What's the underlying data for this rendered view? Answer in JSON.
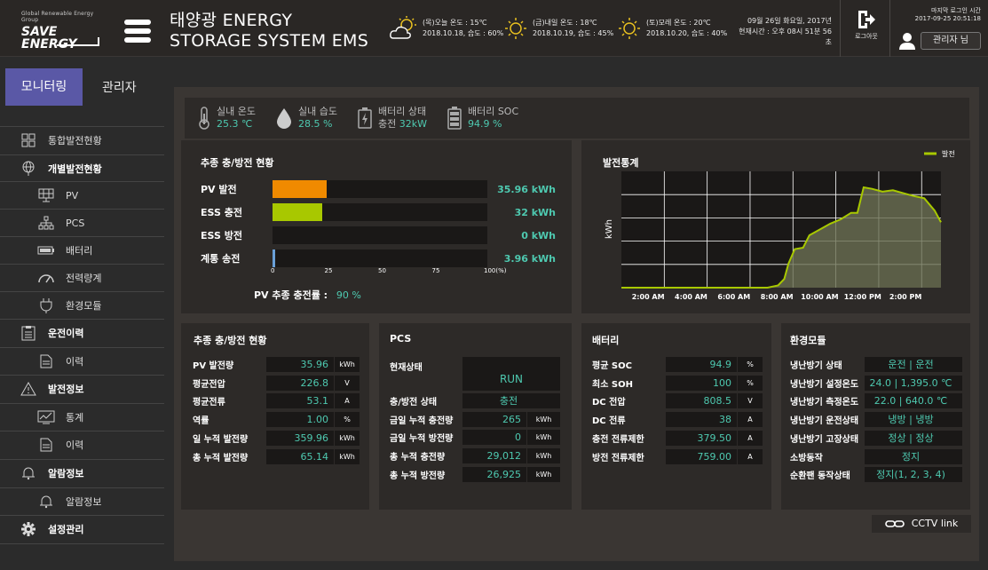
{
  "header": {
    "logo_top": "Global Renewable Energy Group",
    "logo_line1": "SAVE",
    "logo_line2": "ENERGY",
    "title_line1": "태양광 ENERGY",
    "title_line2": "STORAGE SYSTEM EMS",
    "weather": [
      {
        "line1": "(목)오늘  온도 : 15℃",
        "line2": "2018.10.18,  습도 : 60%",
        "icon": "sun-cloud-icon"
      },
      {
        "line1": "(금)내일  온도 : 18℃",
        "line2": "2018.10.19,  습도 : 45%",
        "icon": "sun-icon"
      },
      {
        "line1": "(토)모레  온도 : 20℃",
        "line2": "2018.10.20,  습도 : 40%",
        "icon": "sun-icon"
      }
    ],
    "date_line1": "09월 26일 화요일, 2017년",
    "date_line2": "현재시간 : 오후 08시 51분 56초",
    "logout_label": "로그아웃",
    "last_login_label": "마지막 로그인 시간",
    "last_login_value": "2017-09-25  20:51:18",
    "admin_label": "관리자 님"
  },
  "sidebar": {
    "tab_active": "모니터링",
    "tab_other": "관리자",
    "items": [
      {
        "label": "통합발전현황",
        "icon": "grid-icon",
        "bold": false,
        "sub": false
      },
      {
        "label": "개별발전현황",
        "icon": "globe-icon",
        "bold": true,
        "sub": false
      },
      {
        "label": "PV",
        "icon": "solar-panel-icon",
        "bold": false,
        "sub": true
      },
      {
        "label": "PCS",
        "icon": "network-icon",
        "bold": false,
        "sub": true
      },
      {
        "label": "배터리",
        "icon": "battery-icon",
        "bold": false,
        "sub": true
      },
      {
        "label": "전력량계",
        "icon": "gauge-icon",
        "bold": false,
        "sub": true
      },
      {
        "label": "환경모듈",
        "icon": "plug-icon",
        "bold": false,
        "sub": true
      },
      {
        "label": "운전이력",
        "icon": "clipboard-icon",
        "bold": true,
        "sub": false
      },
      {
        "label": "이력",
        "icon": "document-icon",
        "bold": false,
        "sub": true
      },
      {
        "label": "발전정보",
        "icon": "warning-icon",
        "bold": true,
        "sub": false
      },
      {
        "label": "통계",
        "icon": "chart-icon",
        "bold": false,
        "sub": true
      },
      {
        "label": "이력",
        "icon": "document-icon",
        "bold": false,
        "sub": true
      },
      {
        "label": "알람정보",
        "icon": "bell-icon",
        "bold": true,
        "sub": false
      },
      {
        "label": "알람정보",
        "icon": "bell-icon",
        "bold": false,
        "sub": true
      },
      {
        "label": "설정관리",
        "icon": "gear-icon",
        "bold": true,
        "sub": false
      }
    ]
  },
  "env": [
    {
      "label": "실내 온도",
      "value": "25.3 ℃",
      "icon": "thermometer-icon"
    },
    {
      "label": "실내 습도",
      "value": "28.5 %",
      "icon": "droplet-icon"
    },
    {
      "label": "배터리 상태",
      "value_prefix": "충전",
      "value": "32kW",
      "icon": "battery-charge-icon"
    },
    {
      "label": "배터리 SOC",
      "value": "94.9 %",
      "icon": "battery-full-icon"
    }
  ],
  "charge_panel": {
    "title": "추종 충/방전 현황",
    "rows": [
      {
        "label": "PV 발전",
        "fill": 0.25,
        "color": "#f08a00",
        "value": "35.96 kWh"
      },
      {
        "label": "ESS 충전",
        "fill": 0.23,
        "color": "#a8c800",
        "value": "32 kWh"
      },
      {
        "label": "ESS 방전",
        "fill": 0,
        "color": "#a8c800",
        "value": "0 kWh"
      },
      {
        "label": "계통 송전",
        "fill": 0.012,
        "color": "#6aa0d8",
        "value": "3.96 kWh"
      }
    ],
    "ticks": [
      "0",
      "25",
      "50",
      "75",
      "100(%)"
    ],
    "rate_label": "PV 추종 충전률 :",
    "rate_value": "90 %"
  },
  "chart_data": {
    "type": "area",
    "title": "발전통계",
    "ylabel": "kWh",
    "legend": "발전",
    "legend_position": "top-right",
    "x_ticks": [
      "2:00 AM",
      "4:00 AM",
      "6:00 AM",
      "8:00 AM",
      "10:00 AM",
      "12:00 PM",
      "2:00 PM"
    ],
    "series": [
      {
        "name": "발전",
        "color": "#a8c800",
        "x": [
          0,
          1,
          2,
          3,
          4,
          5,
          6,
          7,
          7.5,
          7.8,
          8,
          8.3,
          8.7,
          9,
          9.5,
          10,
          10.5,
          11,
          11.3,
          11.6,
          12,
          12.5,
          13,
          13.5,
          14,
          14.5,
          15,
          15.3
        ],
        "y": [
          0,
          0,
          0,
          0,
          0,
          0,
          0,
          0,
          0.3,
          1.2,
          3.3,
          5.3,
          5.5,
          7.2,
          8,
          8.8,
          9.4,
          10.3,
          10.3,
          13.8,
          13.6,
          13.2,
          13.4,
          13,
          12.6,
          12.3,
          10.6,
          9
        ]
      }
    ],
    "xlim": [
      0,
      15.3
    ],
    "ylim": [
      0,
      16
    ],
    "grid": true
  },
  "panels": {
    "summary": {
      "title": "추종 충/방전 현황",
      "rows": [
        {
          "label": "PV 발전량",
          "value": "35.96",
          "unit": "kWh"
        },
        {
          "label": "평균전압",
          "value": "226.8",
          "unit": "V"
        },
        {
          "label": "평균전류",
          "value": "53.1",
          "unit": "A"
        },
        {
          "label": "역률",
          "value": "1.00",
          "unit": "%"
        },
        {
          "label": "일 누적 발전량",
          "value": "359.96",
          "unit": "kWh"
        },
        {
          "label": "총 누적 발전량",
          "value": "65.14",
          "unit": "kWh"
        }
      ]
    },
    "pcs": {
      "title": "PCS",
      "status_label": "현재상태",
      "status_value": "RUN",
      "rows": [
        {
          "label": "충/방전 상태",
          "value": "충전",
          "unit": ""
        },
        {
          "label": "금일 누적 충전량",
          "value": "265",
          "unit": "kWh"
        },
        {
          "label": "금일 누적 방전량",
          "value": "0",
          "unit": "kWh"
        },
        {
          "label": "총 누적 충전량",
          "value": "29,012",
          "unit": "kWh"
        },
        {
          "label": "총 누적 방전량",
          "value": "26,925",
          "unit": "kWh"
        }
      ]
    },
    "battery": {
      "title": "배터리",
      "rows": [
        {
          "label": "평균 SOC",
          "value": "94.9",
          "unit": "%"
        },
        {
          "label": "최소 SOH",
          "value": "100",
          "unit": "%"
        },
        {
          "label": "DC 전압",
          "value": "808.5",
          "unit": "V"
        },
        {
          "label": "DC 전류",
          "value": "38",
          "unit": "A"
        },
        {
          "label": "충전 전류제한",
          "value": "379.50",
          "unit": "A"
        },
        {
          "label": "방전 전류제한",
          "value": "759.00",
          "unit": "A"
        }
      ]
    },
    "env_module": {
      "title": "환경모듈",
      "rows": [
        {
          "label": "냉난방기 상태",
          "value": "운전 | 운전"
        },
        {
          "label": "냉난방기 설정온도",
          "value": "24.0 | 1,395.0 ℃"
        },
        {
          "label": "냉난방기 측정온도",
          "value": "22.0 | 640.0 ℃"
        },
        {
          "label": "냉난방기 운전상태",
          "value": "냉방 | 냉방"
        },
        {
          "label": "냉난방기 고장상태",
          "value": "정상 | 정상"
        },
        {
          "label": "소방동작",
          "value": "정지"
        },
        {
          "label": "순환팬 동작상태",
          "value": "정지(1, 2, 3, 4)"
        }
      ]
    }
  },
  "cctv_label": "CCTV link"
}
